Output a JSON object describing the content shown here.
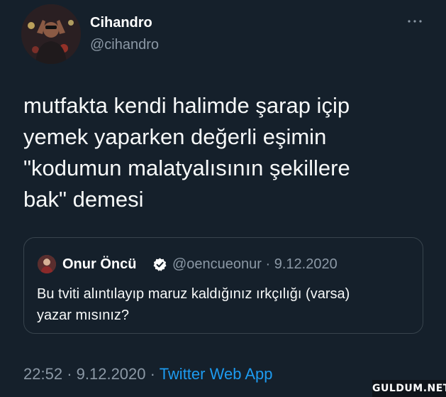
{
  "tweet": {
    "author": {
      "name": "Cihandro",
      "handle": "@cihandro",
      "avatar_icon": "profile-photo"
    },
    "more_icon": "more-horizontal-icon",
    "text_lines": [
      "mutfakta kendi halimde şarap içip",
      "yemek yaparken değerli eşimin",
      "\"kodumun malatyalısının şekillere",
      "bak\" demesi"
    ],
    "quoted": {
      "name": "Onur Öncü",
      "verified_icon": "verified-badge-icon",
      "handle": "@oencueonur",
      "separator": "·",
      "date": "9.12.2020",
      "text_lines": [
        "Bu tviti alıntılayıp maruz kaldığınız ırkçılığı (varsa)",
        "yazar mısınız?"
      ]
    },
    "footer": {
      "time": "22:52",
      "separator": "·",
      "date": "9.12.2020",
      "source": "Twitter Web App"
    }
  },
  "watermark": "GULDUM.NET",
  "colors": {
    "background": "#15202b",
    "text": "#f7f9f9",
    "secondary": "#8b98a5",
    "accent": "#1d9bf0",
    "border": "#38444d"
  }
}
